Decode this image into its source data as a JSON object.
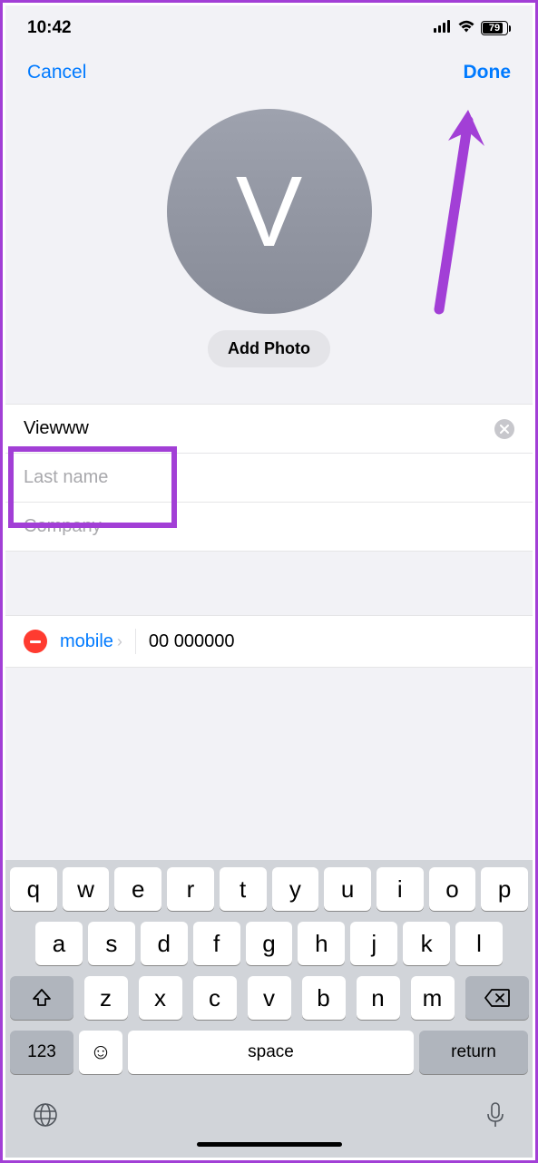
{
  "status": {
    "time": "10:42",
    "battery_pct": "79"
  },
  "nav": {
    "cancel": "Cancel",
    "done": "Done"
  },
  "avatar": {
    "initial": "V",
    "add_photo": "Add Photo"
  },
  "form": {
    "first_name_value": "Viewww",
    "last_name_placeholder": "Last name",
    "company_placeholder": "Company"
  },
  "phone": {
    "label": "mobile",
    "number": "00 000000"
  },
  "keyboard": {
    "row1": [
      "q",
      "w",
      "e",
      "r",
      "t",
      "y",
      "u",
      "i",
      "o",
      "p"
    ],
    "row2": [
      "a",
      "s",
      "d",
      "f",
      "g",
      "h",
      "j",
      "k",
      "l"
    ],
    "row3": [
      "z",
      "x",
      "c",
      "v",
      "b",
      "n",
      "m"
    ],
    "num": "123",
    "space": "space",
    "return": "return"
  }
}
